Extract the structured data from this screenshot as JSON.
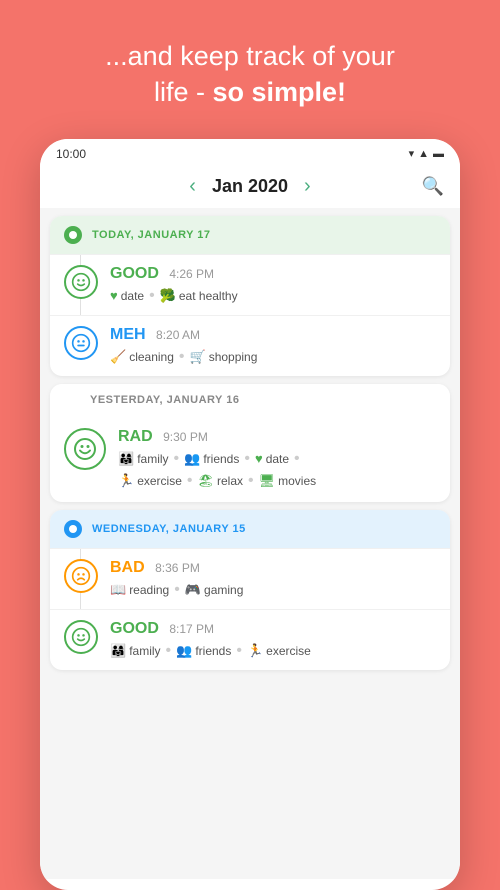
{
  "app": {
    "header_line1": "...and keep track of your",
    "header_line2_normal": "life - ",
    "header_line2_bold": "so simple!"
  },
  "status_bar": {
    "time": "10:00",
    "wifi_icon": "▾",
    "signal_icon": "▲",
    "battery_icon": "▬"
  },
  "month_nav": {
    "prev_arrow": "‹",
    "next_arrow": "›",
    "title": "Jan 2020",
    "search_icon": "🔍"
  },
  "days": [
    {
      "id": "today",
      "type": "today",
      "dot_color": "green",
      "label": "TODAY, JANUARY 17",
      "entries": [
        {
          "mood": "GOOD",
          "mood_class": "good",
          "time": "4:26 PM",
          "face": "😊",
          "tags": [
            {
              "icon": "♥",
              "icon_color": "#4CAF50",
              "label": "date"
            },
            {
              "icon": "🥦",
              "icon_color": "#4CAF50",
              "label": "eat healthy"
            }
          ]
        },
        {
          "mood": "MEH",
          "mood_class": "meh",
          "time": "8:20 AM",
          "face": "😐",
          "tags": [
            {
              "icon": "🧹",
              "icon_color": "#2196F3",
              "label": "cleaning"
            },
            {
              "icon": "🛒",
              "icon_color": "#2196F3",
              "label": "shopping"
            }
          ]
        }
      ]
    },
    {
      "id": "yesterday",
      "type": "yesterday",
      "dot_color": "none",
      "label": "YESTERDAY, JANUARY 16",
      "entries": [
        {
          "mood": "RAD",
          "mood_class": "rad",
          "time": "9:30 PM",
          "face": "😁",
          "tags": [
            {
              "icon": "👨‍👩‍👧",
              "icon_color": "#4CAF50",
              "label": "family"
            },
            {
              "icon": "👥",
              "icon_color": "#4CAF50",
              "label": "friends"
            },
            {
              "icon": "♥",
              "icon_color": "#4CAF50",
              "label": "date"
            },
            {
              "icon": "🏃",
              "icon_color": "#4CAF50",
              "label": "exercise"
            },
            {
              "icon": "🏖",
              "icon_color": "#4CAF50",
              "label": "relax"
            },
            {
              "icon": "🖥",
              "icon_color": "#4CAF50",
              "label": "movies"
            }
          ]
        }
      ]
    },
    {
      "id": "wednesday",
      "type": "wednesday",
      "dot_color": "blue",
      "label": "WEDNESDAY, JANUARY 15",
      "entries": [
        {
          "mood": "BAD",
          "mood_class": "bad",
          "time": "8:36 PM",
          "face": "😞",
          "tags": [
            {
              "icon": "📖",
              "icon_color": "#FF9800",
              "label": "reading"
            },
            {
              "icon": "🎮",
              "icon_color": "#FF9800",
              "label": "gaming"
            }
          ]
        },
        {
          "mood": "GOOD",
          "mood_class": "good",
          "time": "8:17 PM",
          "face": "😊",
          "tags": [
            {
              "icon": "👨‍👩‍👧",
              "icon_color": "#4CAF50",
              "label": "family"
            },
            {
              "icon": "👥",
              "icon_color": "#4CAF50",
              "label": "friends"
            },
            {
              "icon": "🏃",
              "icon_color": "#4CAF50",
              "label": "exercise"
            }
          ]
        }
      ]
    }
  ]
}
